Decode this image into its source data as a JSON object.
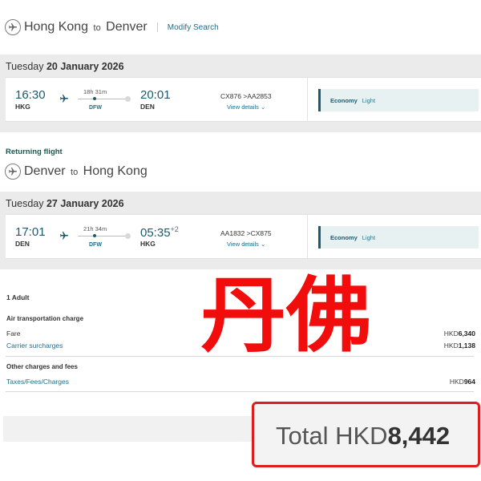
{
  "outbound": {
    "from_city": "Hong Kong",
    "to_word": "to",
    "to_city": "Denver",
    "modify_label": "Modify Search",
    "date_day": "Tuesday",
    "date_text": "20 January 2026",
    "depart_time": "16:30",
    "depart_code": "HKG",
    "duration": "18h 31m",
    "via": "DFW",
    "arrive_time": "20:01",
    "arrive_code": "DEN",
    "flight_1": "CX876",
    "flight_2": "AA2853",
    "view_details": "View details",
    "cabin_class": "Economy",
    "fare_type": "Light"
  },
  "return_label": "Returning flight",
  "inbound": {
    "from_city": "Denver",
    "to_word": "to",
    "to_city": "Hong Kong",
    "date_day": "Tuesday",
    "date_text": "27 January 2026",
    "depart_time": "17:01",
    "depart_code": "DEN",
    "duration": "21h 34m",
    "via": "DFW",
    "arrive_time": "05:35",
    "day_offset": "+2",
    "arrive_code": "HKG",
    "flight_1": "AA1832",
    "flight_2": "CX875",
    "view_details": "View details",
    "cabin_class": "Economy",
    "fare_type": "Light"
  },
  "summary": {
    "passengers": "1 Adult",
    "air_section": "Air transportation charge",
    "fare_label": "Fare",
    "fare_currency": "HKD",
    "fare_amount": "6,340",
    "surcharge_label": "Carrier surcharges",
    "surcharge_currency": "HKD",
    "surcharge_amount": "1,138",
    "other_section": "Other charges and fees",
    "taxes_label": "Taxes/Fees/Charges",
    "taxes_currency": "HKD",
    "taxes_amount": "964"
  },
  "watermark_text": "丹佛",
  "total": {
    "label": "Total",
    "currency": "HKD",
    "amount": "8,442"
  },
  "colors": {
    "accent": "#1d5a6e",
    "link": "#1c6e8c",
    "highlight_border": "#e01d1d",
    "watermark": "#f20d0d"
  }
}
